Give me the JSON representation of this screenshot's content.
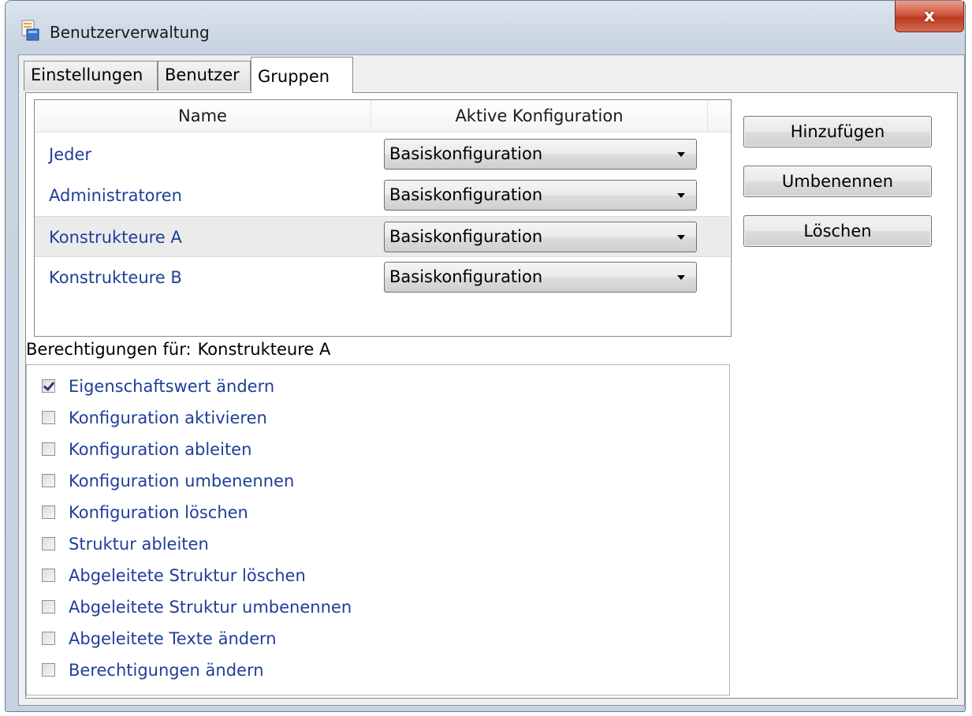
{
  "window": {
    "title": "Benutzerverwaltung",
    "close_label": "x"
  },
  "tabs": [
    {
      "label": "Einstellungen",
      "active": false
    },
    {
      "label": "Benutzer",
      "active": false
    },
    {
      "label": "Gruppen",
      "active": true
    }
  ],
  "groups_table": {
    "columns": [
      "Name",
      "Aktive Konfiguration"
    ],
    "rows": [
      {
        "name": "Jeder",
        "config": "Basiskonfiguration",
        "selected": false
      },
      {
        "name": "Administratoren",
        "config": "Basiskonfiguration",
        "selected": false
      },
      {
        "name": "Konstrukteure A",
        "config": "Basiskonfiguration",
        "selected": true
      },
      {
        "name": "Konstrukteure B",
        "config": "Basiskonfiguration",
        "selected": false
      }
    ]
  },
  "buttons": {
    "add": "Hinzufügen",
    "rename": "Umbenennen",
    "delete": "Löschen"
  },
  "permissions": {
    "title_prefix": "Berechtigungen für:",
    "title_group": "Konstrukteure A",
    "items": [
      {
        "label": "Eigenschaftswert ändern",
        "checked": true
      },
      {
        "label": "Konfiguration aktivieren",
        "checked": false
      },
      {
        "label": "Konfiguration ableiten",
        "checked": false
      },
      {
        "label": "Konfiguration umbenennen",
        "checked": false
      },
      {
        "label": "Konfiguration löschen",
        "checked": false
      },
      {
        "label": "Struktur ableiten",
        "checked": false
      },
      {
        "label": "Abgeleitete Struktur löschen",
        "checked": false
      },
      {
        "label": "Abgeleitete Struktur umbenennen",
        "checked": false
      },
      {
        "label": "Abgeleitete Texte ändern",
        "checked": false
      },
      {
        "label": "Berechtigungen ändern",
        "checked": false
      }
    ]
  },
  "colors": {
    "link_text": "#1e3e9a",
    "selected_row": "#ebebeb",
    "close_button": "#c9462b"
  }
}
